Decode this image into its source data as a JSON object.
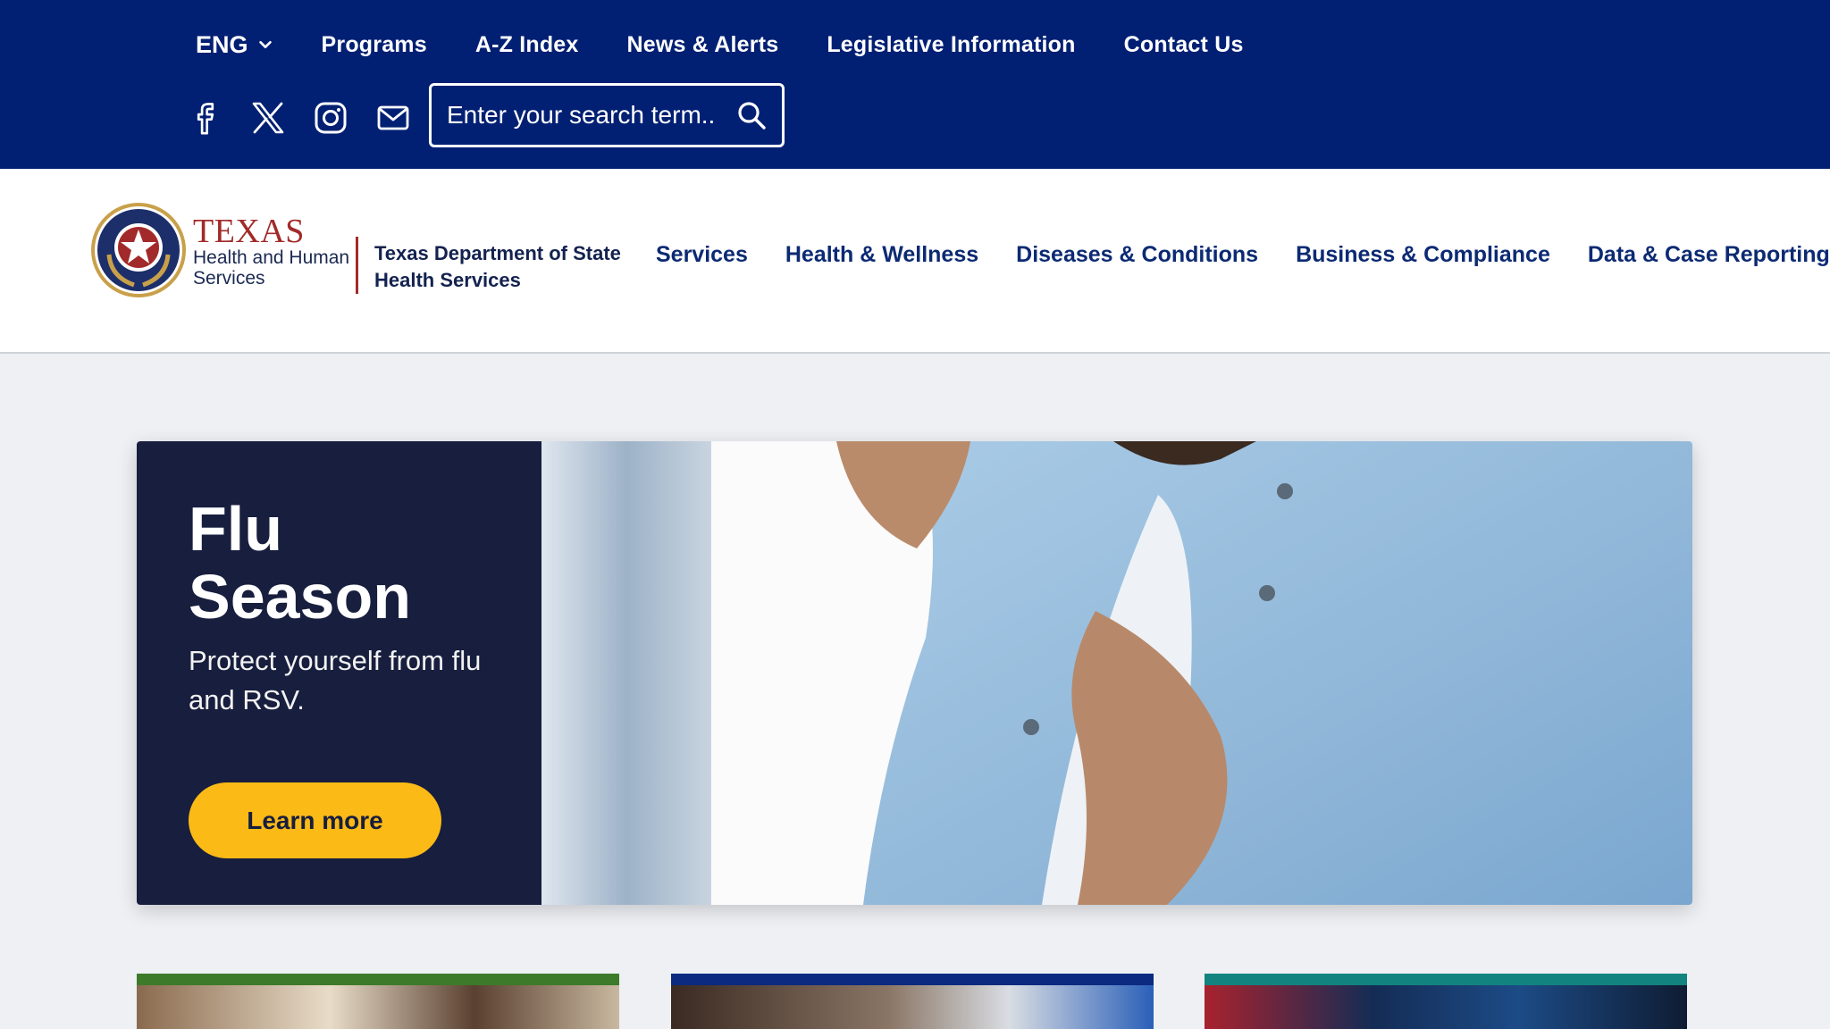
{
  "utility": {
    "language": "ENG",
    "links": [
      "Programs",
      "A-Z Index",
      "News & Alerts",
      "Legislative Information",
      "Contact Us"
    ],
    "social": [
      "facebook-icon",
      "x-icon",
      "instagram-icon",
      "email-icon"
    ],
    "search_placeholder": "Enter your search term.."
  },
  "header": {
    "brand_title": "TEXAS",
    "brand_line1": "Health and Human",
    "brand_line2": "Services",
    "dept_line1": "Texas Department of State",
    "dept_line2": "Health Services",
    "nav": [
      "Services",
      "Health & Wellness",
      "Diseases & Conditions",
      "Business & Compliance",
      "Data & Case Reporting"
    ]
  },
  "hero": {
    "title": "Flu Season",
    "subtitle": "Protect yourself from flu and RSV.",
    "cta": "Learn more"
  },
  "colors": {
    "utility_bg": "#022073",
    "hero_panel": "#171e3e",
    "cta": "#fbba16",
    "nav_text": "#0c2a73",
    "card_bars": [
      "#3d7a2a",
      "#0b2a80",
      "#12837f"
    ]
  }
}
